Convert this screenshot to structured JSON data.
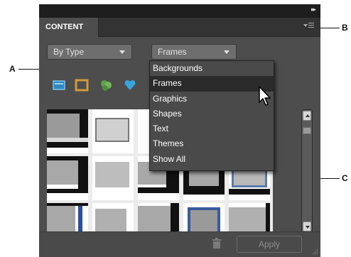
{
  "panel": {
    "tab_label": "CONTENT",
    "collapse_glyph": "▸▸",
    "icons": {
      "collapse": "double-chevron-right-icon",
      "menu": "panel-menu-icon"
    }
  },
  "filters": {
    "type_dropdown": {
      "value": "By Type"
    },
    "category_dropdown": {
      "value": "Frames",
      "options": [
        "Backgrounds",
        "Frames",
        "Graphics",
        "Shapes",
        "Text",
        "Themes",
        "Show All"
      ],
      "highlighted_index": 1
    },
    "filter_icons": [
      "backgrounds-filter-icon",
      "frames-filter-icon",
      "graphics-filter-icon",
      "shapes-filter-icon"
    ]
  },
  "footer": {
    "apply_label": "Apply",
    "icons": {
      "delete": "trash-icon"
    }
  },
  "callouts": {
    "a": "A",
    "b": "B",
    "c": "C"
  },
  "colors": {
    "panel_bg": "#4d4d4d",
    "header_bg": "#1e1e1e",
    "list_highlight": "#2b2b2b",
    "thumb_grid_bg": "#ececec"
  }
}
